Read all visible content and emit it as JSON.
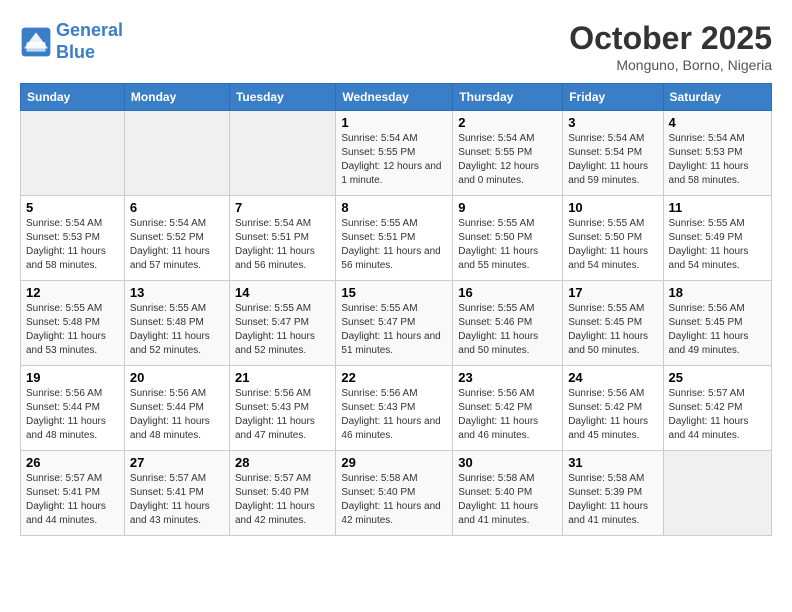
{
  "header": {
    "logo_line1": "General",
    "logo_line2": "Blue",
    "month": "October 2025",
    "location": "Monguno, Borno, Nigeria"
  },
  "days_of_week": [
    "Sunday",
    "Monday",
    "Tuesday",
    "Wednesday",
    "Thursday",
    "Friday",
    "Saturday"
  ],
  "weeks": [
    [
      {
        "day": "",
        "empty": true
      },
      {
        "day": "",
        "empty": true
      },
      {
        "day": "",
        "empty": true
      },
      {
        "day": "1",
        "sunrise": "5:54 AM",
        "sunset": "5:55 PM",
        "daylight": "12 hours and 1 minute."
      },
      {
        "day": "2",
        "sunrise": "5:54 AM",
        "sunset": "5:55 PM",
        "daylight": "12 hours and 0 minutes."
      },
      {
        "day": "3",
        "sunrise": "5:54 AM",
        "sunset": "5:54 PM",
        "daylight": "11 hours and 59 minutes."
      },
      {
        "day": "4",
        "sunrise": "5:54 AM",
        "sunset": "5:53 PM",
        "daylight": "11 hours and 58 minutes."
      }
    ],
    [
      {
        "day": "5",
        "sunrise": "5:54 AM",
        "sunset": "5:53 PM",
        "daylight": "11 hours and 58 minutes."
      },
      {
        "day": "6",
        "sunrise": "5:54 AM",
        "sunset": "5:52 PM",
        "daylight": "11 hours and 57 minutes."
      },
      {
        "day": "7",
        "sunrise": "5:54 AM",
        "sunset": "5:51 PM",
        "daylight": "11 hours and 56 minutes."
      },
      {
        "day": "8",
        "sunrise": "5:55 AM",
        "sunset": "5:51 PM",
        "daylight": "11 hours and 56 minutes."
      },
      {
        "day": "9",
        "sunrise": "5:55 AM",
        "sunset": "5:50 PM",
        "daylight": "11 hours and 55 minutes."
      },
      {
        "day": "10",
        "sunrise": "5:55 AM",
        "sunset": "5:50 PM",
        "daylight": "11 hours and 54 minutes."
      },
      {
        "day": "11",
        "sunrise": "5:55 AM",
        "sunset": "5:49 PM",
        "daylight": "11 hours and 54 minutes."
      }
    ],
    [
      {
        "day": "12",
        "sunrise": "5:55 AM",
        "sunset": "5:48 PM",
        "daylight": "11 hours and 53 minutes."
      },
      {
        "day": "13",
        "sunrise": "5:55 AM",
        "sunset": "5:48 PM",
        "daylight": "11 hours and 52 minutes."
      },
      {
        "day": "14",
        "sunrise": "5:55 AM",
        "sunset": "5:47 PM",
        "daylight": "11 hours and 52 minutes."
      },
      {
        "day": "15",
        "sunrise": "5:55 AM",
        "sunset": "5:47 PM",
        "daylight": "11 hours and 51 minutes."
      },
      {
        "day": "16",
        "sunrise": "5:55 AM",
        "sunset": "5:46 PM",
        "daylight": "11 hours and 50 minutes."
      },
      {
        "day": "17",
        "sunrise": "5:55 AM",
        "sunset": "5:45 PM",
        "daylight": "11 hours and 50 minutes."
      },
      {
        "day": "18",
        "sunrise": "5:56 AM",
        "sunset": "5:45 PM",
        "daylight": "11 hours and 49 minutes."
      }
    ],
    [
      {
        "day": "19",
        "sunrise": "5:56 AM",
        "sunset": "5:44 PM",
        "daylight": "11 hours and 48 minutes."
      },
      {
        "day": "20",
        "sunrise": "5:56 AM",
        "sunset": "5:44 PM",
        "daylight": "11 hours and 48 minutes."
      },
      {
        "day": "21",
        "sunrise": "5:56 AM",
        "sunset": "5:43 PM",
        "daylight": "11 hours and 47 minutes."
      },
      {
        "day": "22",
        "sunrise": "5:56 AM",
        "sunset": "5:43 PM",
        "daylight": "11 hours and 46 minutes."
      },
      {
        "day": "23",
        "sunrise": "5:56 AM",
        "sunset": "5:42 PM",
        "daylight": "11 hours and 46 minutes."
      },
      {
        "day": "24",
        "sunrise": "5:56 AM",
        "sunset": "5:42 PM",
        "daylight": "11 hours and 45 minutes."
      },
      {
        "day": "25",
        "sunrise": "5:57 AM",
        "sunset": "5:42 PM",
        "daylight": "11 hours and 44 minutes."
      }
    ],
    [
      {
        "day": "26",
        "sunrise": "5:57 AM",
        "sunset": "5:41 PM",
        "daylight": "11 hours and 44 minutes."
      },
      {
        "day": "27",
        "sunrise": "5:57 AM",
        "sunset": "5:41 PM",
        "daylight": "11 hours and 43 minutes."
      },
      {
        "day": "28",
        "sunrise": "5:57 AM",
        "sunset": "5:40 PM",
        "daylight": "11 hours and 42 minutes."
      },
      {
        "day": "29",
        "sunrise": "5:58 AM",
        "sunset": "5:40 PM",
        "daylight": "11 hours and 42 minutes."
      },
      {
        "day": "30",
        "sunrise": "5:58 AM",
        "sunset": "5:40 PM",
        "daylight": "11 hours and 41 minutes."
      },
      {
        "day": "31",
        "sunrise": "5:58 AM",
        "sunset": "5:39 PM",
        "daylight": "11 hours and 41 minutes."
      },
      {
        "day": "",
        "empty": true
      }
    ]
  ],
  "labels": {
    "sunrise": "Sunrise:",
    "sunset": "Sunset:",
    "daylight": "Daylight hours"
  }
}
